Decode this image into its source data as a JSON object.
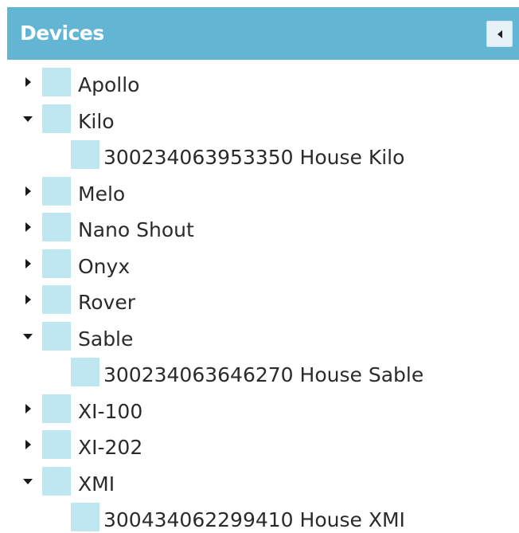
{
  "panel": {
    "title": "Devices",
    "header_color": "#62b5d3",
    "node_icon_color": "#bfe7f1",
    "collapse_button_icon": "caret-left-icon"
  },
  "tree": [
    {
      "label": "Apollo",
      "expanded": false,
      "children": []
    },
    {
      "label": "Kilo",
      "expanded": true,
      "children": [
        {
          "label": "300234063953350 House Kilo"
        }
      ]
    },
    {
      "label": "Melo",
      "expanded": false,
      "children": []
    },
    {
      "label": "Nano Shout",
      "expanded": false,
      "children": []
    },
    {
      "label": "Onyx",
      "expanded": false,
      "children": []
    },
    {
      "label": "Rover",
      "expanded": false,
      "children": []
    },
    {
      "label": "Sable",
      "expanded": true,
      "children": [
        {
          "label": "300234063646270 House Sable"
        }
      ]
    },
    {
      "label": "XI-100",
      "expanded": false,
      "children": []
    },
    {
      "label": "XI-202",
      "expanded": false,
      "children": []
    },
    {
      "label": "XMI",
      "expanded": true,
      "children": [
        {
          "label": "300434062299410 House XMI"
        }
      ]
    }
  ]
}
